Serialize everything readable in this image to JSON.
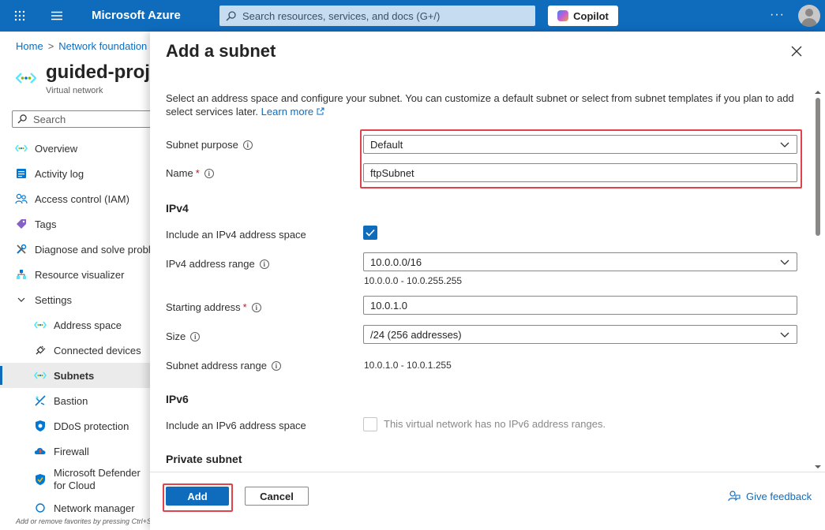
{
  "topbar": {
    "brand": "Microsoft Azure",
    "search_placeholder": "Search resources, services, and docs (G+/)",
    "copilot_label": "Copilot",
    "more_label": "···"
  },
  "left": {
    "breadcrumb": {
      "home": "Home",
      "sep": ">",
      "current": "Network foundation"
    },
    "resource_title": "guided-project",
    "resource_type": "Virtual network",
    "search_placeholder": "Search",
    "nav": [
      {
        "label": "Overview",
        "icon": "vnet-icon"
      },
      {
        "label": "Activity log",
        "icon": "activity-log-icon"
      },
      {
        "label": "Access control (IAM)",
        "icon": "people-icon"
      },
      {
        "label": "Tags",
        "icon": "tag-icon"
      },
      {
        "label": "Diagnose and solve problems",
        "icon": "wrench-icon"
      },
      {
        "label": "Resource visualizer",
        "icon": "visualizer-icon"
      },
      {
        "label": "Settings",
        "icon": "chevron-down-icon"
      },
      {
        "label": "Address space",
        "icon": "vnet-icon"
      },
      {
        "label": "Connected devices",
        "icon": "plug-icon"
      },
      {
        "label": "Subnets",
        "icon": "vnet-icon"
      },
      {
        "label": "Bastion",
        "icon": "bastion-icon"
      },
      {
        "label": "DDoS protection",
        "icon": "shield-icon"
      },
      {
        "label": "Firewall",
        "icon": "firewall-icon"
      },
      {
        "label": "Microsoft Defender for Cloud",
        "icon": "defender-icon"
      },
      {
        "label": "Network manager",
        "icon": "network-manager-icon"
      }
    ],
    "favorites_hint": "Add or remove favorites by pressing Ctrl+Shift+F"
  },
  "panel": {
    "title": "Add a subnet",
    "description": "Select an address space and configure your subnet. You can customize a default subnet or select from subnet templates if you plan to add select services later.",
    "learn_more": "Learn more",
    "subnet_purpose": {
      "label": "Subnet purpose",
      "value": "Default"
    },
    "name": {
      "label": "Name",
      "required": "*",
      "value": "ftpSubnet"
    },
    "ipv4_section": "IPv4",
    "include_ipv4": {
      "label": "Include an IPv4 address space",
      "checked": true
    },
    "ipv4_range": {
      "label": "IPv4 address range",
      "value": "10.0.0.0/16",
      "hint": "10.0.0.0 - 10.0.255.255"
    },
    "starting_address": {
      "label": "Starting address",
      "required": "*",
      "value": "10.0.1.0"
    },
    "size": {
      "label": "Size",
      "value": "/24 (256 addresses)"
    },
    "subnet_range": {
      "label": "Subnet address range",
      "value": "10.0.1.0 - 10.0.1.255"
    },
    "ipv6_section": "IPv6",
    "include_ipv6": {
      "label": "Include an IPv6 address space",
      "checked": false,
      "note": "This virtual network has no IPv6 address ranges."
    },
    "private_section": "Private subnet",
    "footer": {
      "add": "Add",
      "cancel": "Cancel",
      "feedback": "Give feedback"
    }
  },
  "colors": {
    "accent": "#0f6cbd",
    "highlight": "#e0434b"
  }
}
